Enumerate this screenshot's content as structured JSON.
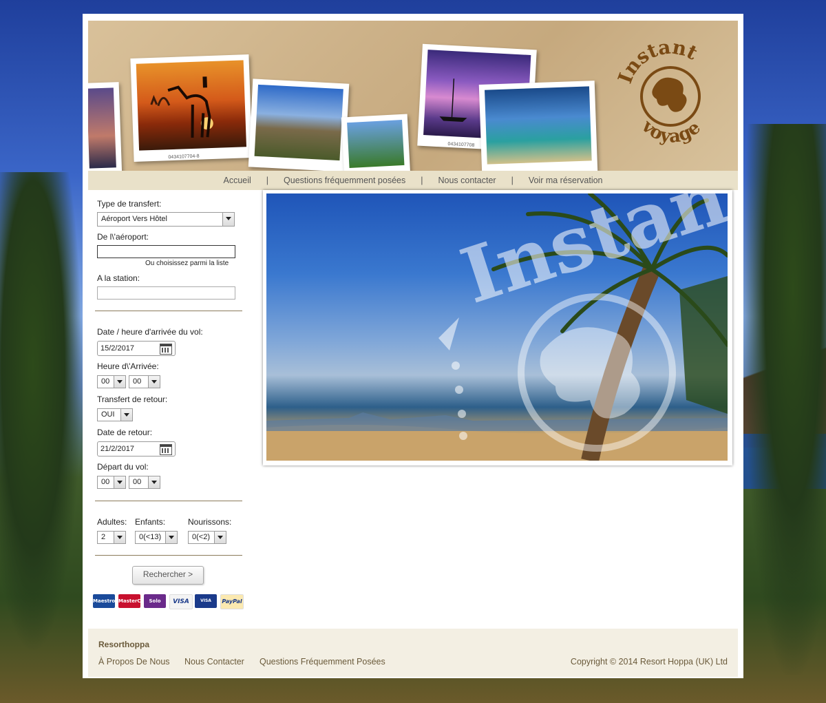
{
  "nav": {
    "items": [
      "Accueil",
      "Questions fréquemment posées",
      "Nous contacter",
      "Voir ma réservation"
    ],
    "separator": "|"
  },
  "banner": {
    "logo_top": "Instant",
    "logo_bottom": "voyage",
    "photo_caption_1": "0434107704-8",
    "photo_caption_2": "0434107708"
  },
  "form": {
    "transfer_type_label": "Type de transfert:",
    "transfer_type_value": "Aéroport Vers Hôtel",
    "from_airport_label": "De l\\'aéroport:",
    "from_airport_value": "",
    "choose_list_link": "Ou choisissez parmi la liste",
    "to_station_label": "A la station:",
    "to_station_value": "",
    "arrival_datetime_label": "Date / heure d'arrivée du vol:",
    "arrival_date": "15/2/2017",
    "arrival_time_label": "Heure d\\'Arrivée:",
    "arrival_hour": "00",
    "arrival_minute": "00",
    "return_transfer_label": "Transfert de retour:",
    "return_transfer_value": "OUI",
    "return_date_label": "Date de retour:",
    "return_date": "21/2/2017",
    "departure_label": "Départ du vol:",
    "departure_hour": "00",
    "departure_minute": "00",
    "adults_label": "Adultes:",
    "adults_value": "2",
    "children_label": "Enfants:",
    "children_value": "0(<13)",
    "infants_label": "Nourissons:",
    "infants_value": "0(<2)",
    "search_button": "Rechercher >"
  },
  "payments": [
    "Maestro",
    "MasterCard",
    "Solo",
    "VISA",
    "VISA Electron",
    "PayPal"
  ],
  "hero": {
    "watermark": "Instant"
  },
  "footer": {
    "brand": "Resorthoppa",
    "links": [
      "À Propos De Nous",
      "Nous Contacter",
      "Questions Fréquemment Posées"
    ],
    "copyright": "Copyright © 2014 Resort Hoppa (UK) Ltd"
  },
  "colors": {
    "nav_bg": "#e9e1c9",
    "footer_bg": "#f3efe3",
    "footer_text": "#6a5a3a",
    "divider": "#8a7a5a"
  }
}
